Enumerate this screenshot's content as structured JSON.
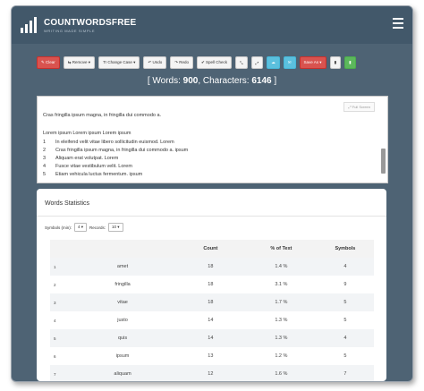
{
  "header": {
    "logo_text": "COUNTWORDSFREE",
    "logo_subtext": "WRITING MADE SIMPLE"
  },
  "toolbar": {
    "buttons": [
      {
        "label": "✎ Clear",
        "style": "red"
      },
      {
        "label": "⇆ Remove ▾",
        "style": "default"
      },
      {
        "label": "Tr Change Case ▾",
        "style": "default"
      },
      {
        "label": "↶ Undo",
        "style": "default"
      },
      {
        "label": "↷ Redo",
        "style": "default"
      },
      {
        "label": "✔ Spell Check",
        "style": "default"
      },
      {
        "label": "⤡",
        "style": "default"
      },
      {
        "label": "⤢",
        "style": "default"
      },
      {
        "label": "☁",
        "style": "blue"
      },
      {
        "label": "✉",
        "style": "blue"
      },
      {
        "label": "Save As ▾",
        "style": "red"
      },
      {
        "label": "▮",
        "style": "default"
      },
      {
        "label": "▮",
        "style": "green"
      }
    ]
  },
  "counts": {
    "words_label": "[ Words:",
    "words_value": "900",
    "chars_label": ", Characters:",
    "chars_value": "6146",
    "close": "]"
  },
  "editor": {
    "fullscreen_label": "⤢ Full Screen",
    "first_line": "Cras fringilla ipsum magna, in fringilla dui commodo a.",
    "second_line": "Lorem ipsum Lorem ipsum Lorem ipsum",
    "list": [
      {
        "num": "1",
        "text": "In eleifend velit vitae libero sollicitudin euismod.      Lorem"
      },
      {
        "num": "2",
        "text": "Cras fringilla ipsum magna, in fringilla dui commodo a.   ipsum"
      },
      {
        "num": "3",
        "text": "Aliquam erat volutpat.    Lorem"
      },
      {
        "num": "4",
        "text": "Fusce vitae vestibulum velit.      Lorem"
      },
      {
        "num": "5",
        "text": "Etiam vehicula luctus fermentum.      ipsum"
      }
    ]
  },
  "words_statistics": {
    "title": "Words Statistics",
    "symbols_label": "Symbols (min):",
    "symbols_value": "4 ▾",
    "records_label": "Records:",
    "records_value": "10 ▾",
    "columns": [
      "",
      "",
      "Count",
      "% of Text",
      "Symbols"
    ],
    "rows": [
      {
        "idx": "1",
        "word": "amet",
        "count": "18",
        "pct": "1.4 %",
        "symbols": "4"
      },
      {
        "idx": "2",
        "word": "fringilla",
        "count": "18",
        "pct": "3.1 %",
        "symbols": "9"
      },
      {
        "idx": "3",
        "word": "vitae",
        "count": "18",
        "pct": "1.7 %",
        "symbols": "5"
      },
      {
        "idx": "4",
        "word": "justo",
        "count": "14",
        "pct": "1.3 %",
        "symbols": "5"
      },
      {
        "idx": "5",
        "word": "quis",
        "count": "14",
        "pct": "1.3 %",
        "symbols": "4"
      },
      {
        "idx": "6",
        "word": "ipsum",
        "count": "13",
        "pct": "1.2 %",
        "symbols": "5"
      },
      {
        "idx": "7",
        "word": "aliquam",
        "count": "12",
        "pct": "1.6 %",
        "symbols": "7"
      }
    ]
  }
}
